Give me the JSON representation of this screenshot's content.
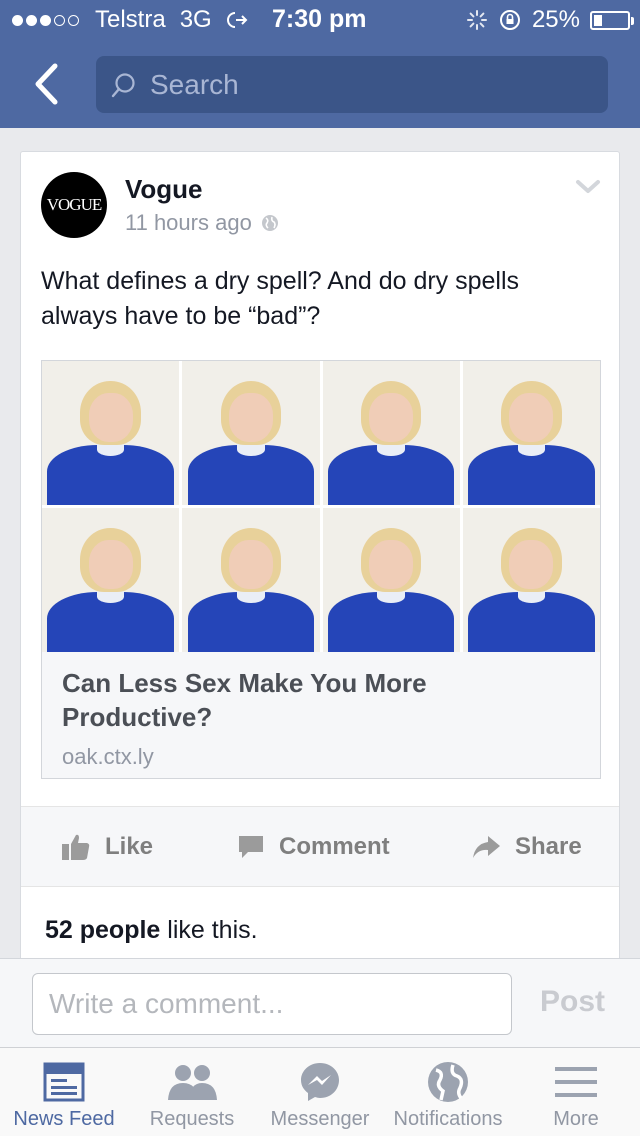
{
  "status_bar": {
    "carrier": "Telstra",
    "network": "3G",
    "time": "7:30 pm",
    "battery": "25%",
    "battery_level": 0.25
  },
  "nav": {
    "search_placeholder": "Search"
  },
  "post": {
    "page_name": "Vogue",
    "avatar_text": "VOGUE",
    "time_ago": "11 hours ago",
    "text": "What defines a dry spell? And do dry spells always have to be “bad”?",
    "link": {
      "title": "Can Less Sex Make You More Productive?",
      "domain": "oak.ctx.ly"
    },
    "actions": {
      "like": "Like",
      "comment": "Comment",
      "share": "Share"
    },
    "likes": {
      "count": "52 people",
      "suffix": " like this."
    }
  },
  "comment_bar": {
    "placeholder": "Write a comment...",
    "post_label": "Post"
  },
  "tabs": [
    {
      "label": "News Feed",
      "icon": "news-feed-icon",
      "active": true
    },
    {
      "label": "Requests",
      "icon": "friend-requests-icon",
      "active": false
    },
    {
      "label": "Messenger",
      "icon": "messenger-icon",
      "active": false
    },
    {
      "label": "Notifications",
      "icon": "globe-icon",
      "active": false
    },
    {
      "label": "More",
      "icon": "menu-icon",
      "active": false
    }
  ],
  "colors": {
    "brand": "#4e69a2",
    "search_bg": "#3b5588",
    "action_gray": "#7f7f7f",
    "tab_inactive": "#9197a3"
  }
}
